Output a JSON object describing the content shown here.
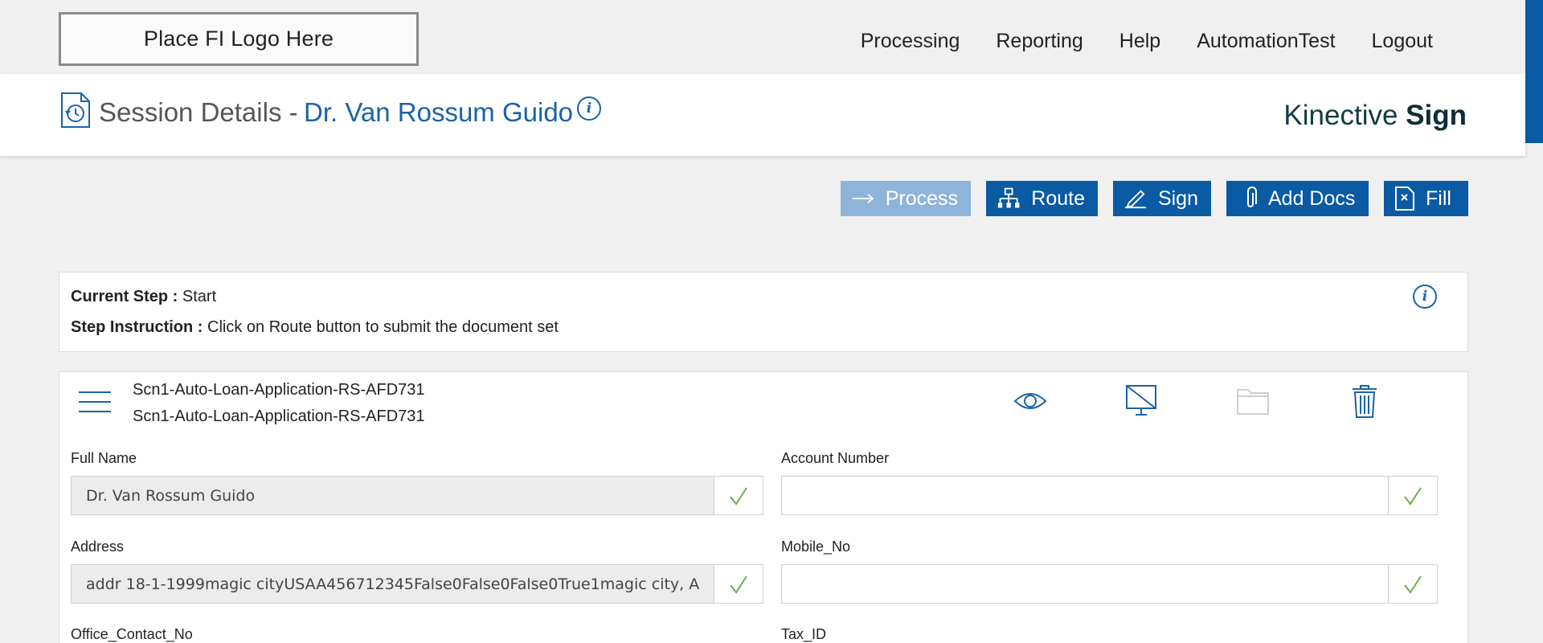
{
  "logo": {
    "text": "Place FI Logo Here"
  },
  "nav": {
    "items": [
      "Processing",
      "Reporting",
      "Help",
      "AutomationTest",
      "Logout"
    ]
  },
  "header": {
    "title": "Session Details -",
    "name": "Dr. Van Rossum Guido",
    "info_icon": "i",
    "brand_light": "Kinective ",
    "brand_bold": "Sign"
  },
  "actions": {
    "process": "Process",
    "route": "Route",
    "sign": "Sign",
    "add_docs": "Add Docs",
    "fill": "Fill"
  },
  "step": {
    "current_label": "Current Step :",
    "current_value": "Start",
    "instruction_label": "Step Instruction :",
    "instruction_value": "Click on Route button to submit the document set",
    "info_icon": "i"
  },
  "document": {
    "name_line1": "Scn1-Auto-Loan-Application-RS-AFD731",
    "name_line2": "Scn1-Auto-Loan-Application-RS-AFD731",
    "icons": [
      "eye-icon",
      "monitor-off-icon",
      "folder-icon",
      "trash-icon"
    ]
  },
  "fields": {
    "full_name": {
      "label": "Full Name",
      "value": "Dr. Van Rossum Guido"
    },
    "account_number": {
      "label": "Account Number",
      "value": ""
    },
    "address": {
      "label": "Address",
      "value": "addr 18-1-1999magic cityUSAA456712345False0False0False0True1magic city, A"
    },
    "mobile_no": {
      "label": "Mobile_No",
      "value": ""
    },
    "office_contact_no": {
      "label": "Office_Contact_No"
    },
    "tax_id": {
      "label": "Tax_ID"
    }
  },
  "colors": {
    "primary": "#0a5aa4",
    "primary_disabled": "#8fb4d9",
    "link_blue": "#1b63a8",
    "check_green": "#6ab04c",
    "page_bg": "#f0f0f0"
  }
}
